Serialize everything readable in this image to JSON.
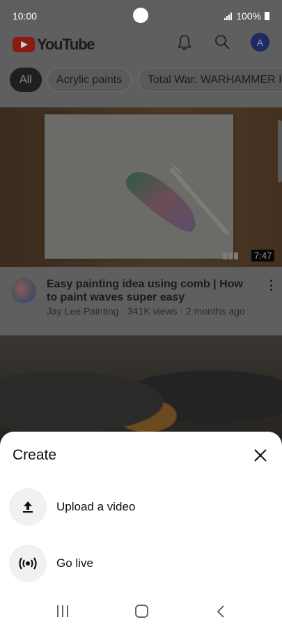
{
  "status_bar": {
    "time": "10:00",
    "battery": "100%"
  },
  "app_bar": {
    "logo_text": "YouTube",
    "account_initial": "A"
  },
  "chips": [
    {
      "label": "All",
      "active": true
    },
    {
      "label": "Acrylic paints",
      "active": false
    },
    {
      "label": "Total War: WARHAMMER II",
      "active": false
    }
  ],
  "video": {
    "duration": "7:47",
    "title": "Easy painting idea using comb | How to paint waves super easy",
    "meta": "Jay Lee Painting · 341K views · 2 months ago"
  },
  "sheet": {
    "title": "Create",
    "items": [
      {
        "label": "Upload a video",
        "icon": "upload-icon"
      },
      {
        "label": "Go live",
        "icon": "live-broadcast-icon"
      }
    ]
  },
  "colors": {
    "brand_red_dimmed": "#8a1b12",
    "avatar": "#1e2b63",
    "sheet_bg": "#ffffff"
  }
}
